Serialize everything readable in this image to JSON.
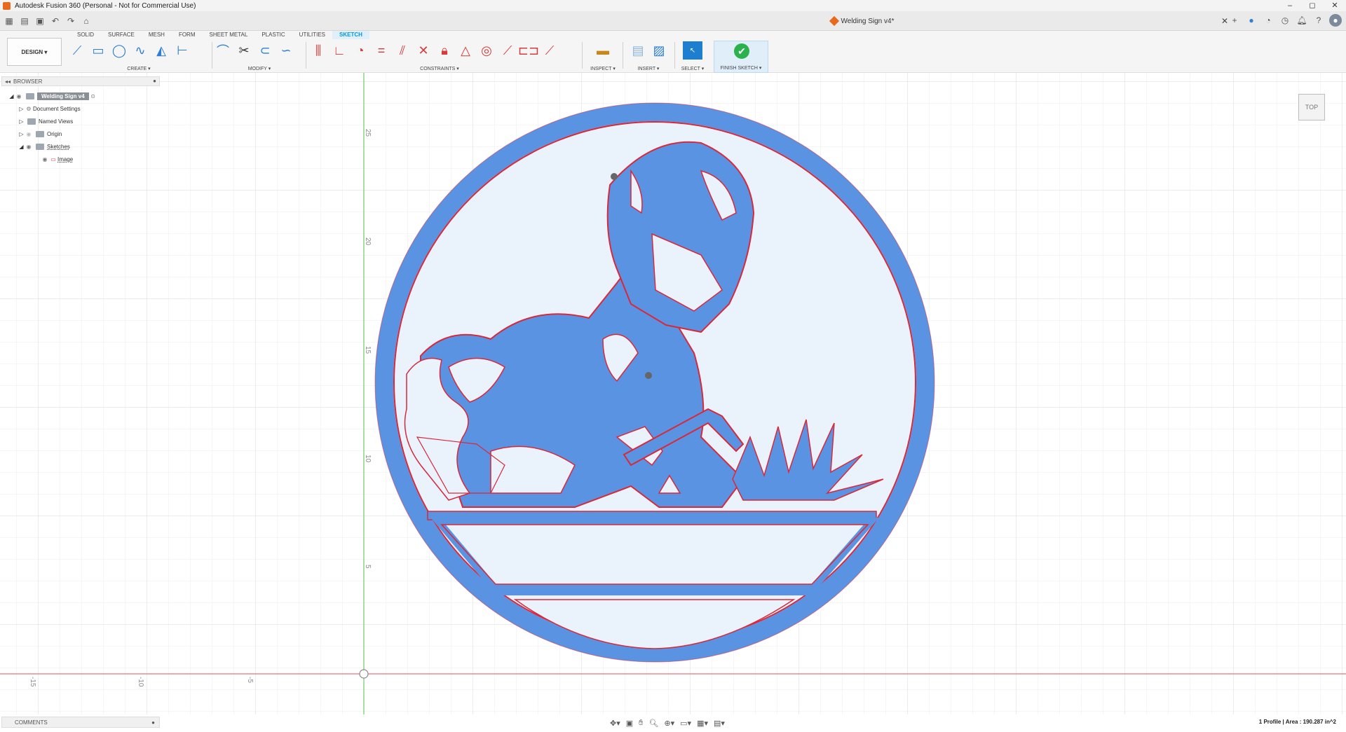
{
  "app": {
    "title": "Autodesk Fusion 360 (Personal - Not for Commercial Use)"
  },
  "document": {
    "tab_title": "Welding Sign v4*"
  },
  "ribbon": {
    "workspace": "DESIGN",
    "tabs": [
      "SOLID",
      "SURFACE",
      "MESH",
      "FORM",
      "SHEET METAL",
      "PLASTIC",
      "UTILITIES",
      "SKETCH"
    ],
    "active_tab": "SKETCH",
    "groups": {
      "create": "CREATE",
      "modify": "MODIFY",
      "constraints": "CONSTRAINTS",
      "inspect": "INSPECT",
      "insert": "INSERT",
      "select": "SELECT",
      "finish": "FINISH SKETCH"
    }
  },
  "browser": {
    "title": "BROWSER",
    "items": [
      {
        "label": "Welding Sign v4"
      },
      {
        "label": "Document Settings"
      },
      {
        "label": "Named Views"
      },
      {
        "label": "Origin"
      },
      {
        "label": "Sketches"
      },
      {
        "label": "Image"
      }
    ]
  },
  "canvas": {
    "y_ticks": [
      "25",
      "20",
      "15",
      "10",
      "5"
    ],
    "x_ticks": [
      "-15",
      "-10",
      "-5"
    ]
  },
  "viewcube": {
    "label": "TOP"
  },
  "comments": {
    "label": "COMMENTS"
  },
  "status": {
    "text": "1 Profile | Area : 190.287 in^2"
  },
  "colors": {
    "accent": "#0696d7",
    "sketch_fill": "#5b93e3",
    "sketch_line": "#d8283a",
    "finish": "#2bb24c"
  }
}
